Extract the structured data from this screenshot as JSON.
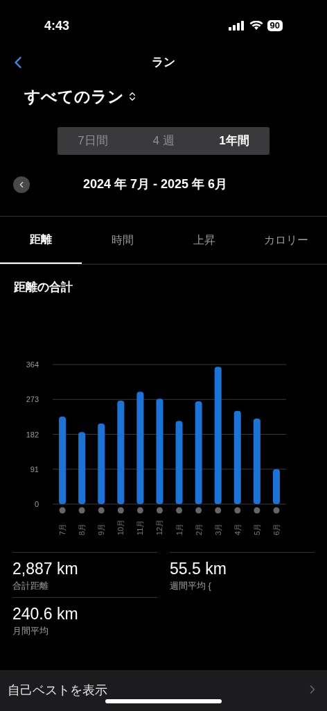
{
  "status_bar": {
    "time": "4:43",
    "battery": "90"
  },
  "nav": {
    "title": "ラン"
  },
  "filter": {
    "label": "すべてのラン"
  },
  "periods": [
    {
      "label": "7日間",
      "selected": false
    },
    {
      "label": "4 週",
      "selected": false
    },
    {
      "label": "1年間",
      "selected": true
    }
  ],
  "date_range": "2024 年 7月 - 2025 年 6月",
  "tabs": [
    {
      "label": "距離",
      "selected": true
    },
    {
      "label": "時間",
      "selected": false
    },
    {
      "label": "上昇",
      "selected": false
    },
    {
      "label": "カロリー",
      "selected": false
    }
  ],
  "section_title": "距離の合計",
  "chart_data": {
    "type": "bar",
    "categories": [
      "7月",
      "8月",
      "9月",
      "10月",
      "11月",
      "12月",
      "1月",
      "2月",
      "3月",
      "4月",
      "5月",
      "6月"
    ],
    "grid": true,
    "series": [
      {
        "color": "#1a73d6",
        "values": [
          228,
          188,
          210,
          270,
          293,
          275,
          217,
          268,
          358,
          243,
          223,
          91
        ]
      }
    ],
    "ylim": [
      0,
      364
    ],
    "yticks": [
      0,
      91,
      182,
      273,
      364
    ]
  },
  "stats": [
    {
      "value": "2,887 km",
      "label": "合計距離"
    },
    {
      "value": "55.5 km",
      "label": "週間平均 {"
    },
    {
      "value": "240.6 km",
      "label": "月間平均"
    }
  ],
  "bottom_link": {
    "label": "自己ベストを表示"
  }
}
